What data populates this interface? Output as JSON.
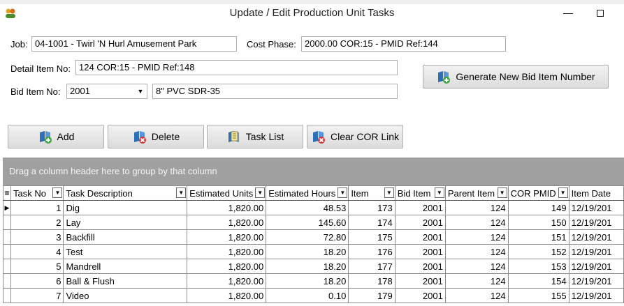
{
  "window": {
    "title": "Update / Edit Production Unit Tasks",
    "minimize_glyph": "—"
  },
  "form": {
    "job_label": "Job:",
    "job_value": "04-1001  - Twirl 'N Hurl Amusement Park",
    "cost_phase_label": "Cost Phase:",
    "cost_phase_value": "2000.00 COR:15 - PMID Ref:144",
    "detail_item_label": "Detail Item No:",
    "detail_item_value": "124 COR:15 - PMID Ref:148",
    "bid_item_label": "Bid Item No:",
    "bid_item_value": "2001",
    "bid_item_desc": "8\" PVC SDR-35",
    "generate_button": "Generate New Bid Item Number"
  },
  "toolbar": {
    "add_label": "Add",
    "delete_label": "Delete",
    "task_list_label": "Task List",
    "clear_cor_label": "Clear COR Link"
  },
  "grid": {
    "group_panel_text": "Drag a column header here to group by that column",
    "columns": [
      "Task No",
      "Task Description",
      "Estimated Units",
      "Estimated Hours",
      "Item",
      "Bid Item",
      "Parent Item",
      "COR PMID",
      "Item Date"
    ],
    "rows": [
      [
        "1",
        "Dig",
        "1,820.00",
        "48.53",
        "173",
        "2001",
        "124",
        "149",
        "12/19/201"
      ],
      [
        "2",
        "Lay",
        "1,820.00",
        "145.60",
        "174",
        "2001",
        "124",
        "150",
        "12/19/201"
      ],
      [
        "3",
        "Backfill",
        "1,820.00",
        "72.80",
        "175",
        "2001",
        "124",
        "151",
        "12/19/201"
      ],
      [
        "4",
        "Test",
        "1,820.00",
        "18.20",
        "176",
        "2001",
        "124",
        "152",
        "12/19/201"
      ],
      [
        "5",
        "Mandrell",
        "1,820.00",
        "18.20",
        "177",
        "2001",
        "124",
        "153",
        "12/19/201"
      ],
      [
        "6",
        "Ball & Flush",
        "1,820.00",
        "18.20",
        "178",
        "2001",
        "124",
        "154",
        "12/19/201"
      ],
      [
        "7",
        "Video",
        "1,820.00",
        "0.10",
        "179",
        "2001",
        "124",
        "155",
        "12/19/201"
      ]
    ]
  },
  "colors": {
    "group_panel_bg": "#a0a0a0",
    "icon_blue": "#2e6fb5",
    "icon_green": "#3aa53a",
    "icon_red": "#d9322b"
  }
}
